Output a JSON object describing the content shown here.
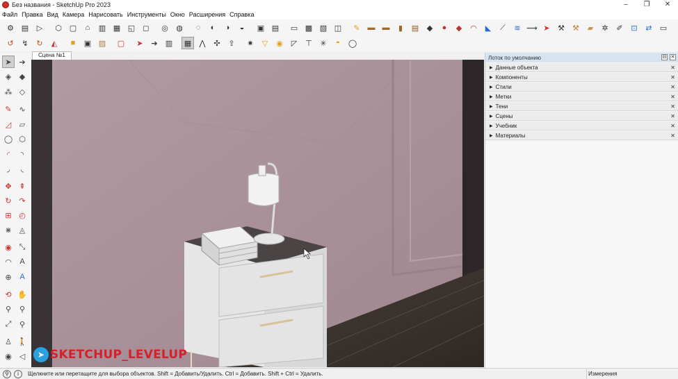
{
  "window": {
    "title": "Без названия - SketchUp Pro 2023",
    "controls": [
      "–",
      "❐",
      "✕"
    ]
  },
  "menu": [
    "Файл",
    "Правка",
    "Вид",
    "Камера",
    "Нарисовать",
    "Инструменты",
    "Окно",
    "Расширения",
    "Справка"
  ],
  "scene_tab": "Сцена №1",
  "tray": {
    "title": "Лоток по умолчанию",
    "items": [
      "Данные объекта",
      "Компоненты",
      "Стили",
      "Метки",
      "Тени",
      "Сцены",
      "Учебник",
      "Материалы"
    ]
  },
  "status": {
    "message": "Щелкните или перетащите для выбора объектов. Shift = Добавить/Удалить. Ctrl = Добавить. Shift + Ctrl = Удалить.",
    "measurements_label": "Измерения"
  },
  "watermark": {
    "text": "SKETCHUP_LEVELUP"
  },
  "colors": {
    "wall": "#a88f97",
    "floor": "#3a332e",
    "nightstand": "#dedede",
    "accent_blue": "#2aa0e0",
    "brand_red": "#d4202a"
  }
}
